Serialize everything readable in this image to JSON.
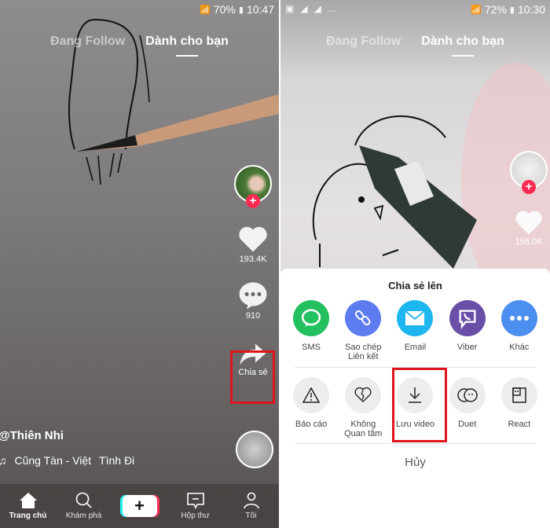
{
  "left_screen": {
    "status_bar": {
      "battery": "70%",
      "time": "10:47"
    },
    "tabs": [
      {
        "label": "Đang Follow"
      },
      {
        "label": "Dành cho bạn",
        "active": true
      }
    ],
    "actions": {
      "likes": "193.4K",
      "comments": "910",
      "share_label": "Chia sẻ"
    },
    "author": "@Thiên Nhi",
    "music": {
      "title": "Cũng Tàn - Việt",
      "extra": "Tình Đi"
    },
    "nav": [
      {
        "label": "Trang chủ",
        "icon": "home-icon",
        "active": true
      },
      {
        "label": "Khám phá",
        "icon": "search-icon"
      },
      {
        "label": "+",
        "icon": "create-icon"
      },
      {
        "label": "Hộp thư",
        "icon": "inbox-icon"
      },
      {
        "label": "Tôi",
        "icon": "profile-icon"
      }
    ]
  },
  "right_screen": {
    "status_bar": {
      "battery": "72%",
      "time": "10:30",
      "notifications": "..."
    },
    "tabs": [
      {
        "label": "Đang Follow"
      },
      {
        "label": "Dành cho bạn",
        "active": true
      }
    ],
    "actions": {
      "likes": "158.0K"
    },
    "share_sheet": {
      "title": "Chia sẻ lên",
      "share_options": [
        {
          "label": "SMS",
          "icon": "sms-icon",
          "color": "#22c05f"
        },
        {
          "label": "Sao chép Liên kết",
          "line1": "Sao chép",
          "line2": "Liên kết",
          "icon": "link-icon",
          "color": "#5c7cf0"
        },
        {
          "label": "Email",
          "icon": "email-icon",
          "color": "#1eb6ee"
        },
        {
          "label": "Viber",
          "icon": "viber-icon",
          "color": "#6a4fa8"
        },
        {
          "label": "Khác",
          "icon": "more-icon",
          "color": "#4b8ff0"
        }
      ],
      "action_options": [
        {
          "label": "Báo cáo",
          "icon": "warning-icon"
        },
        {
          "label": "Không Quan tâm",
          "line1": "Không",
          "line2": "Quan tâm",
          "icon": "broken-heart-icon"
        },
        {
          "label": "Lưu video",
          "icon": "download-icon"
        },
        {
          "label": "Duet",
          "icon": "duet-icon"
        },
        {
          "label": "React",
          "icon": "react-icon"
        }
      ],
      "cancel_label": "Hủy"
    }
  },
  "colors": {
    "highlight": "#e0141e",
    "accent_pink": "#fe2c55",
    "accent_cyan": "#25f4ee"
  }
}
